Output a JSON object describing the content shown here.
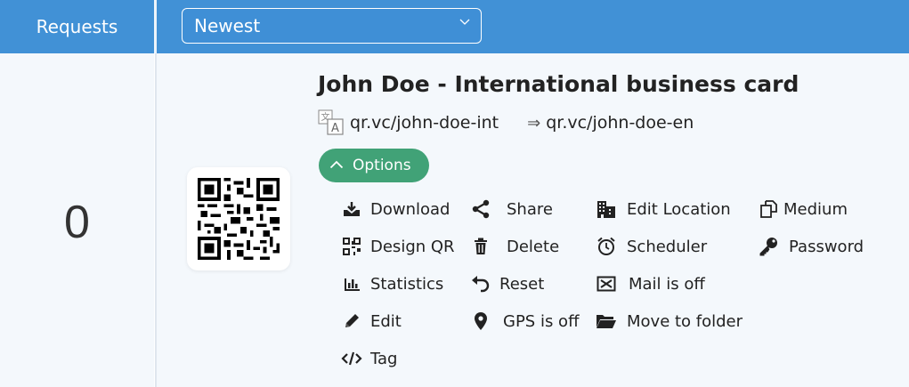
{
  "header": {
    "requests_label": "Requests",
    "sort": {
      "selected": "Newest",
      "chevron_icon": "chevron-down-icon"
    }
  },
  "row": {
    "count": "0",
    "title": "John Doe - International business card",
    "short_url": "qr.vc/john-doe-int",
    "arrow": "⇒",
    "target_url": "qr.vc/john-doe-en",
    "options_label": "Options",
    "menu": [
      {
        "label": "Download",
        "icon": "download-icon"
      },
      {
        "label": "Design QR",
        "icon": "qr-design-icon"
      },
      {
        "label": "Statistics",
        "icon": "bar-chart-icon"
      },
      {
        "label": "Edit",
        "icon": "pencil-icon"
      },
      {
        "label": "Tag",
        "icon": "code-tag-icon"
      },
      {
        "label": "Share",
        "icon": "share-icon"
      },
      {
        "label": "Delete",
        "icon": "trash-icon"
      },
      {
        "label": "Reset",
        "icon": "undo-icon"
      },
      {
        "label": "GPS is off",
        "icon": "map-pin-icon"
      },
      {
        "label": "Edit Location",
        "icon": "building-icon"
      },
      {
        "label": "Scheduler",
        "icon": "alarm-clock-icon"
      },
      {
        "label": "Mail is off",
        "icon": "envelope-x-icon"
      },
      {
        "label": "Move to folder",
        "icon": "folder-icon"
      },
      {
        "label": "Medium",
        "icon": "copy-icon"
      },
      {
        "label": "Password",
        "icon": "key-icon"
      }
    ]
  },
  "colors": {
    "header": "#4191d6",
    "options": "#41a277",
    "body_bg": "#f4f8fc"
  }
}
